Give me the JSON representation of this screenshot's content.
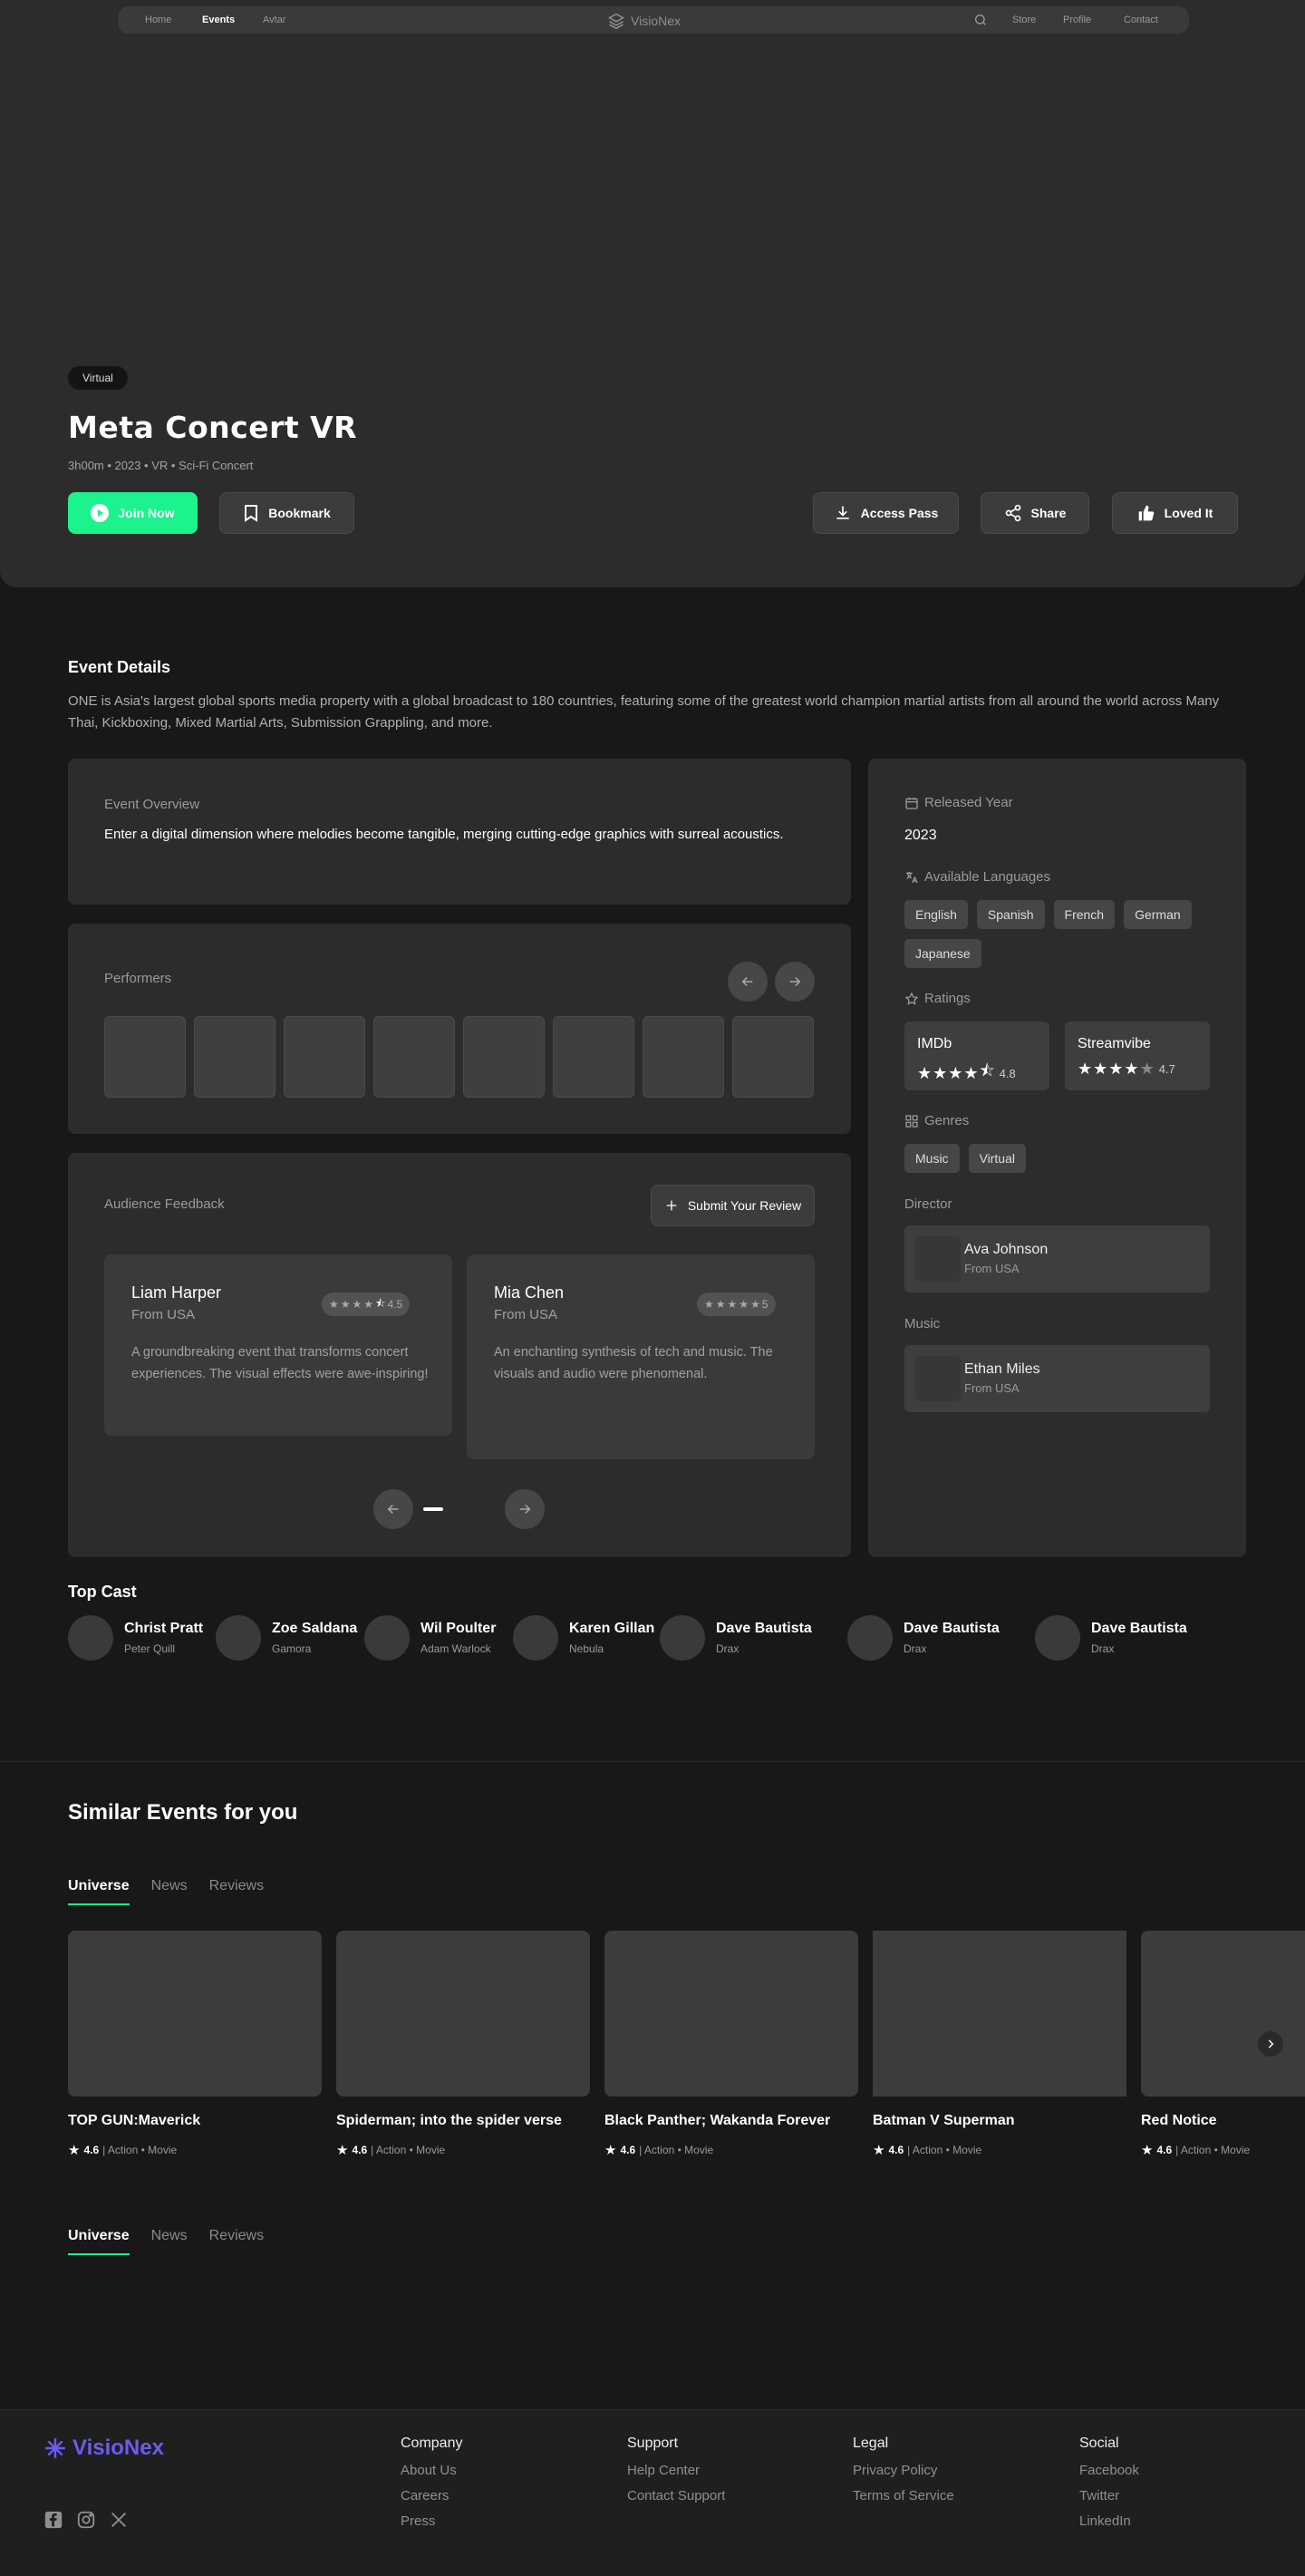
{
  "nav": {
    "items": [
      "Home",
      "Events",
      "Avtar"
    ],
    "brand": "VisioNex",
    "right_items": [
      "Store",
      "Profile",
      "Contact"
    ]
  },
  "hero": {
    "badge": "Virtual",
    "title": "Meta Concert VR",
    "meta": "3h00m • 2023 • VR • Sci-Fi Concert",
    "join_label": "Join Now",
    "bookmark_label": "Bookmark",
    "access_label": "Access Pass",
    "share_label": "Share",
    "love_label": "Loved It"
  },
  "details": {
    "heading": "Event Details",
    "description": "ONE is Asia's largest global sports media property with a global broadcast to 180 countries, featuring some of the greatest world champion martial artists from all around the world across Many Thai, Kickboxing, Mixed Martial Arts, Submission Grappling, and more.",
    "overview_label": "Event Overview",
    "overview_text": "Enter a digital dimension where melodies become tangible, merging cutting-edge graphics with surreal acoustics.",
    "performers_label": "Performers",
    "feedback_label": "Audience Feedback",
    "submit_review": "Submit Your Review",
    "reviews": [
      {
        "name": "Liam Harper",
        "from": "From USA",
        "rating": "4.5",
        "text": "A groundbreaking event that transforms concert experiences. The visual effects were awe-inspiring!"
      },
      {
        "name": "Mia Chen",
        "from": "From USA",
        "rating": "5",
        "text": "An enchanting synthesis of tech and music. The visuals and audio were phenomenal."
      }
    ]
  },
  "side": {
    "released_label": "Released Year",
    "released_value": "2023",
    "languages_label": "Available Languages",
    "languages": [
      "English",
      "Spanish",
      "French",
      "German",
      "Japanese"
    ],
    "ratings_label": "Ratings",
    "ratings": [
      {
        "source": "IMDb",
        "value": "4.8"
      },
      {
        "source": "Streamvibe",
        "value": "4.7"
      }
    ],
    "genres_label": "Genres",
    "genres": [
      "Music",
      "Virtual"
    ],
    "director_label": "Director",
    "director": {
      "name": "Ava Johnson",
      "from": "From USA"
    },
    "music_label": "Music",
    "music": {
      "name": "Ethan Miles",
      "from": "From USA"
    }
  },
  "cast": {
    "heading": "Top Cast",
    "members": [
      {
        "name": "Christ Pratt",
        "role": "Peter Quill"
      },
      {
        "name": "Zoe Saldana",
        "role": "Gamora"
      },
      {
        "name": "Wil Poulter",
        "role": "Adam Warlock"
      },
      {
        "name": "Karen Gillan",
        "role": "Nebula"
      },
      {
        "name": "Dave Bautista",
        "role": "Drax"
      },
      {
        "name": "Dave Bautista",
        "role": "Drax"
      },
      {
        "name": "Dave Bautista",
        "role": "Drax"
      }
    ]
  },
  "similar": {
    "heading": "Similar Events for you",
    "tabs": [
      "Universe",
      "News",
      "Reviews"
    ],
    "movies": [
      {
        "title": "TOP GUN:Maverick",
        "rating": "4.6",
        "tags": "| Action • Movie"
      },
      {
        "title": "Spiderman; into the spider verse",
        "rating": "4.6",
        "tags": "| Action • Movie"
      },
      {
        "title": "Black Panther; Wakanda Forever",
        "rating": "4.6",
        "tags": "| Action • Movie"
      },
      {
        "title": "Batman V Superman",
        "rating": "4.6",
        "tags": "| Action • Movie"
      },
      {
        "title": "Red Notice",
        "rating": "4.6",
        "tags": "| Action • Movie"
      }
    ]
  },
  "footer": {
    "brand": "VisioNex",
    "columns": [
      {
        "heading": "Company",
        "links": [
          "About Us",
          "Careers",
          "Press"
        ]
      },
      {
        "heading": "Support",
        "links": [
          "Help Center",
          "Contact Support"
        ]
      },
      {
        "heading": "Legal",
        "links": [
          "Privacy Policy",
          "Terms of Service"
        ]
      },
      {
        "heading": "Social",
        "links": [
          "Facebook",
          "Twitter",
          "LinkedIn"
        ]
      }
    ]
  },
  "colors": {
    "accent": "#1cf28d",
    "brand": "#6b5cf0",
    "star": "#ffffff"
  }
}
